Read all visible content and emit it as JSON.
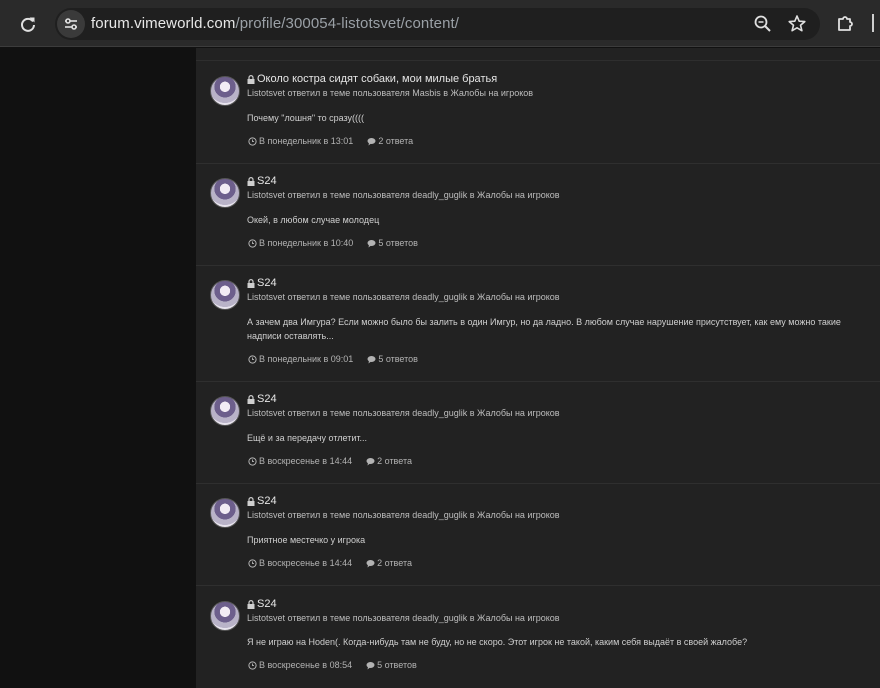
{
  "browser": {
    "url_host": "forum.vimeworld.com",
    "url_path": "/profile/300054-listotsvet/content/"
  },
  "feed": {
    "items": [
      {
        "title": "Около костра сидят собаки, мои милые братья",
        "meta": "Listotsvet ответил в теме пользователя Masbis в Жалобы на игроков",
        "excerpt": "Почему \"лошня\" то сразу((((",
        "time": "В понедельник в 13:01",
        "replies": "2 ответа"
      },
      {
        "title": "S24",
        "meta": "Listotsvet ответил в теме пользователя deadly_guglik в Жалобы на игроков",
        "excerpt": "Окей, в любом случае молодец",
        "time": "В понедельник в 10:40",
        "replies": "5 ответов"
      },
      {
        "title": "S24",
        "meta": "Listotsvet ответил в теме пользователя deadly_guglik в Жалобы на игроков",
        "excerpt": "А зачем два Имгура? Если можно было бы залить в один Имгур, но да ладно. В любом случае нарушение присутствует, как ему можно такие надписи оставлять...",
        "time": "В понедельник в 09:01",
        "replies": "5 ответов"
      },
      {
        "title": "S24",
        "meta": "Listotsvet ответил в теме пользователя deadly_guglik в Жалобы на игроков",
        "excerpt": "Ещё и за передачу отлетит...",
        "time": "В воскресенье в 14:44",
        "replies": "2 ответа"
      },
      {
        "title": "S24",
        "meta": "Listotsvet ответил в теме пользователя deadly_guglik в Жалобы на игроков",
        "excerpt": "Приятное местечко у игрока",
        "time": "В воскресенье в 14:44",
        "replies": "2 ответа"
      },
      {
        "title": "S24",
        "meta": "Listotsvet ответил в теме пользователя deadly_guglik в Жалобы на игроков",
        "excerpt": "Я не играю на Hoden(. Когда-нибудь там не буду, но не скоро. Этот игрок не такой, каким себя выдаёт в своей жалобе?",
        "time": "В воскресенье в 08:54",
        "replies": "5 ответов"
      }
    ]
  }
}
